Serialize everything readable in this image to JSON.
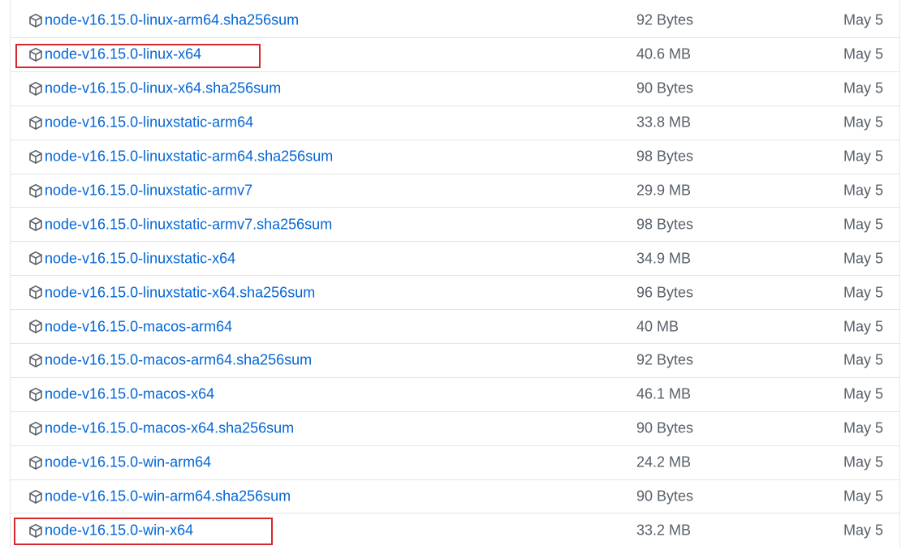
{
  "assets": [
    {
      "name": "node-v16.15.0-linux-arm64.sha256sum",
      "size": "92 Bytes",
      "date": "May 5"
    },
    {
      "name": "node-v16.15.0-linux-x64",
      "size": "40.6 MB",
      "date": "May 5",
      "highlighted": true
    },
    {
      "name": "node-v16.15.0-linux-x64.sha256sum",
      "size": "90 Bytes",
      "date": "May 5"
    },
    {
      "name": "node-v16.15.0-linuxstatic-arm64",
      "size": "33.8 MB",
      "date": "May 5"
    },
    {
      "name": "node-v16.15.0-linuxstatic-arm64.sha256sum",
      "size": "98 Bytes",
      "date": "May 5"
    },
    {
      "name": "node-v16.15.0-linuxstatic-armv7",
      "size": "29.9 MB",
      "date": "May 5"
    },
    {
      "name": "node-v16.15.0-linuxstatic-armv7.sha256sum",
      "size": "98 Bytes",
      "date": "May 5"
    },
    {
      "name": "node-v16.15.0-linuxstatic-x64",
      "size": "34.9 MB",
      "date": "May 5"
    },
    {
      "name": "node-v16.15.0-linuxstatic-x64.sha256sum",
      "size": "96 Bytes",
      "date": "May 5"
    },
    {
      "name": "node-v16.15.0-macos-arm64",
      "size": "40 MB",
      "date": "May 5"
    },
    {
      "name": "node-v16.15.0-macos-arm64.sha256sum",
      "size": "92 Bytes",
      "date": "May 5"
    },
    {
      "name": "node-v16.15.0-macos-x64",
      "size": "46.1 MB",
      "date": "May 5"
    },
    {
      "name": "node-v16.15.0-macos-x64.sha256sum",
      "size": "90 Bytes",
      "date": "May 5"
    },
    {
      "name": "node-v16.15.0-win-arm64",
      "size": "24.2 MB",
      "date": "May 5"
    },
    {
      "name": "node-v16.15.0-win-arm64.sha256sum",
      "size": "90 Bytes",
      "date": "May 5"
    },
    {
      "name": "node-v16.15.0-win-x64",
      "size": "33.2 MB",
      "date": "May 5",
      "highlighted": true
    }
  ],
  "icon": "package-icon",
  "colors": {
    "link": "#0366d6",
    "muted": "#586069",
    "border": "#e1e4e8",
    "highlight": "#d9262c"
  }
}
